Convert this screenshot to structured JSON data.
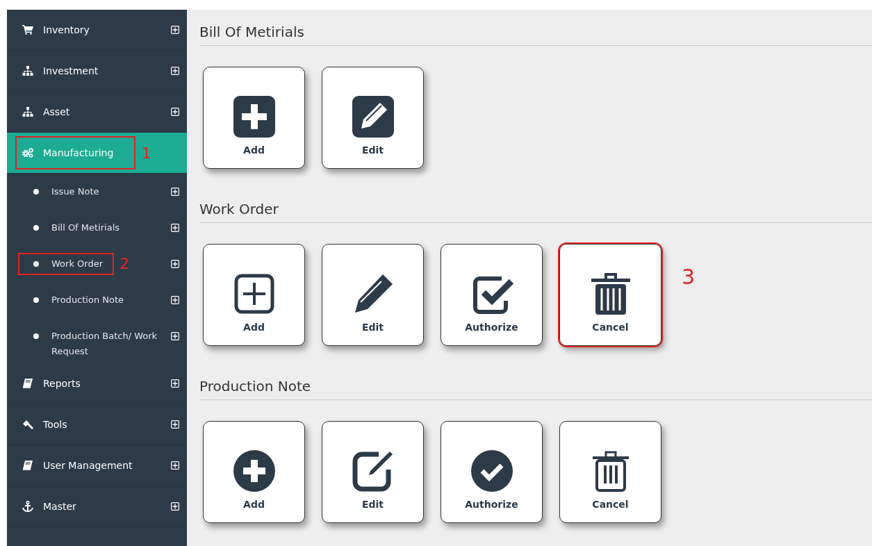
{
  "sidebar": {
    "items": [
      {
        "label": "Inventory",
        "kind": "cart",
        "selected": false,
        "expanded": false
      },
      {
        "label": "Investment",
        "kind": "sitemap",
        "selected": false,
        "expanded": false
      },
      {
        "label": "Asset",
        "kind": "sitemap",
        "selected": false,
        "expanded": false
      },
      {
        "label": "Manufacturing",
        "kind": "gears",
        "selected": true,
        "expanded": true,
        "mark": "1",
        "children": [
          {
            "label": "Issue Note"
          },
          {
            "label": "Bill Of Metirials"
          },
          {
            "label": "Work Order",
            "mark": "2"
          },
          {
            "label": "Production Note"
          },
          {
            "label": "Production Batch/ Work Request"
          }
        ]
      },
      {
        "label": "Reports",
        "kind": "book",
        "selected": false,
        "expanded": false
      },
      {
        "label": "Tools",
        "kind": "gavel",
        "selected": false,
        "expanded": false
      },
      {
        "label": "User Management",
        "kind": "book",
        "selected": false,
        "expanded": false
      },
      {
        "label": "Master",
        "kind": "anchor",
        "selected": false,
        "expanded": false
      }
    ]
  },
  "sections": [
    {
      "title": "Bill Of Metirials",
      "buttons": [
        {
          "label": "Add",
          "kind": "plus-square"
        },
        {
          "label": "Edit",
          "kind": "pencil-square"
        }
      ]
    },
    {
      "title": "Work Order",
      "buttons": [
        {
          "label": "Add",
          "kind": "plus-outline"
        },
        {
          "label": "Edit",
          "kind": "pencil"
        },
        {
          "label": "Authorize",
          "kind": "check-square"
        },
        {
          "label": "Cancel",
          "kind": "trash",
          "mark": "3"
        }
      ]
    },
    {
      "title": "Production Note",
      "buttons": [
        {
          "label": "Add",
          "kind": "plus-circle"
        },
        {
          "label": "Edit",
          "kind": "edit-box"
        },
        {
          "label": "Authorize",
          "kind": "check-circle"
        },
        {
          "label": "Cancel",
          "kind": "trash-outline"
        }
      ]
    }
  ]
}
